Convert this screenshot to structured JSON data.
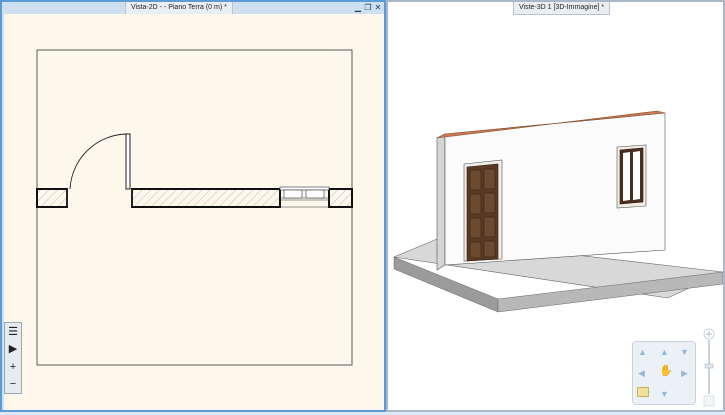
{
  "left_window": {
    "title": "Vista-2D - - Piano Terra (0 m) *",
    "buttons": {
      "minimize": "▁",
      "restore": "❐",
      "close": "✕"
    }
  },
  "right_window": {
    "title": "Viste-3D 1 [3D-Immagine] *"
  },
  "left_toolbar": {
    "items": [
      {
        "name": "layers-list-icon",
        "glyph": "☰"
      },
      {
        "name": "play-icon",
        "glyph": "▶"
      },
      {
        "name": "zoom-in",
        "glyph": "+"
      },
      {
        "name": "zoom-out",
        "glyph": "−"
      }
    ]
  },
  "navigator": {
    "arrows": {
      "up": "▲",
      "down": "▼",
      "left": "◀",
      "right": "▶",
      "hand": "✋"
    }
  },
  "colors": {
    "active_border": "#5b9bd5",
    "plan_background": "#fdf7ec",
    "wall_hatch": "#555555",
    "door_wood": "#5a3b26",
    "wall_top": "#c97b52"
  }
}
